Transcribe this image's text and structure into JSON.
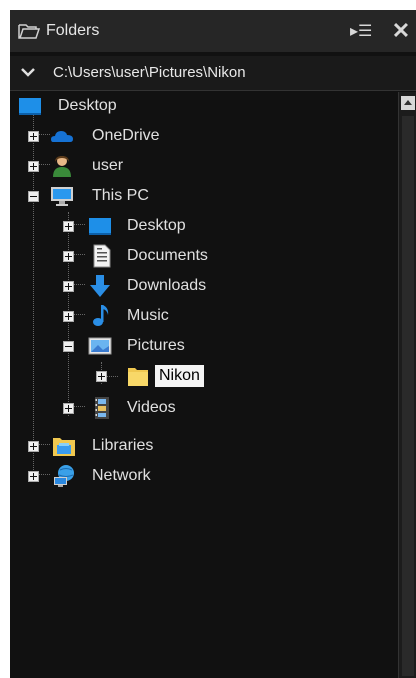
{
  "header": {
    "title": "Folders",
    "close_glyph": "✕",
    "pin_glyph": "▸☰"
  },
  "path": {
    "value": "C:\\Users\\user\\Pictures\\Nikon"
  },
  "tree": {
    "desktop_root": "Desktop",
    "onedrive": "OneDrive",
    "user": "user",
    "this_pc": "This PC",
    "desktop": "Desktop",
    "documents": "Documents",
    "downloads": "Downloads",
    "music": "Music",
    "pictures": "Pictures",
    "nikon": "Nikon",
    "videos": "Videos",
    "libraries": "Libraries",
    "network": "Network"
  },
  "colors": {
    "panel_bg": "#111111",
    "title_bg": "#262626",
    "desktop_blue": "#1e8fe8",
    "selection_bg": "#f4f4f4"
  }
}
